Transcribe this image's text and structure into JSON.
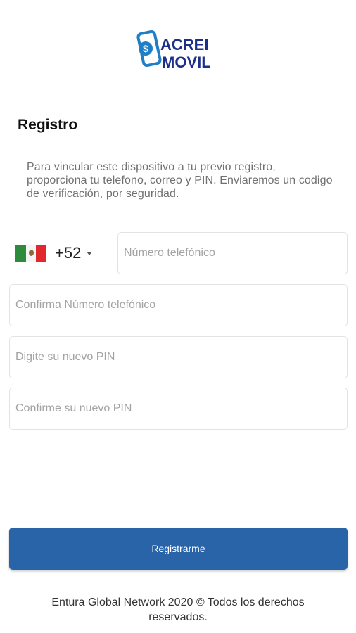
{
  "app": {
    "logo_text_line1": "ACREI",
    "logo_text_line2": "MOVIL",
    "logo_symbol": "$"
  },
  "page": {
    "title": "Registro",
    "description": "Para vincular este dispositivo a tu previo registro, proporciona tu telefono, correo y PIN. Enviaremos un codigo de verificación, por seguridad."
  },
  "country_selector": {
    "flag_icon": "mexico-flag-icon",
    "code": "+52"
  },
  "form": {
    "phone_placeholder": "Número telefónico",
    "confirm_phone_placeholder": "Confirma Número telefónico",
    "pin_placeholder": "Digite su nuevo PIN",
    "confirm_pin_placeholder": "Confirme su nuevo PIN"
  },
  "actions": {
    "register_label": "Registrarme"
  },
  "footer": {
    "text": "Entura Global Network 2020 © Todos los derechos reservados."
  },
  "colors": {
    "primary": "#2a64a8",
    "logo_blue": "#1f7fc4",
    "logo_navy": "#1c2f8a"
  }
}
